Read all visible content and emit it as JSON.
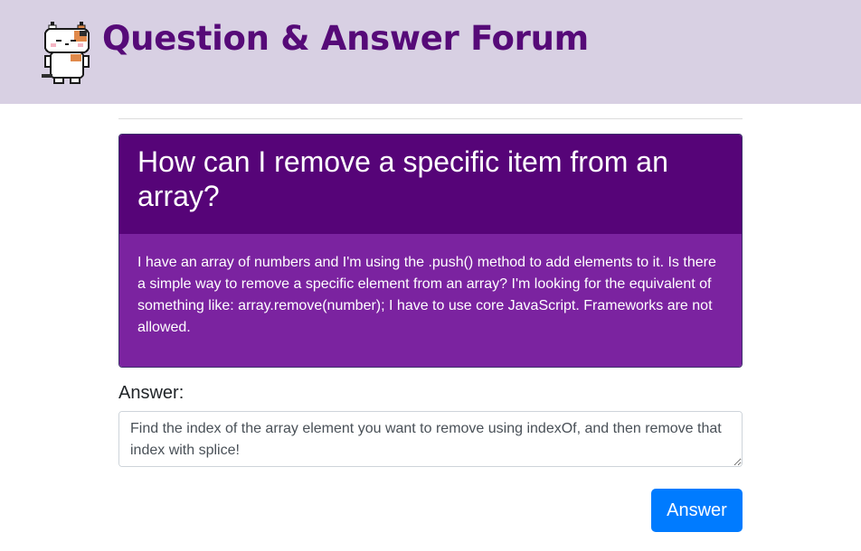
{
  "header": {
    "title": "Question & Answer Forum",
    "logo_icon": "pixel-cat-icon",
    "background": "#d8d0e3",
    "title_color": "#560a78"
  },
  "question": {
    "title": "How can I remove a specific item from an array?",
    "body": "I have an array of numbers and I'm using the .push() method to add elements to it. Is there a simple way to remove a specific element from an array? I'm looking for the equivalent of something like: array.remove(number); I have to use core JavaScript. Frameworks are not allowed.",
    "head_color": "#560478",
    "body_color": "#7b23a0"
  },
  "answer_form": {
    "label": "Answer:",
    "value": "Find the index of the array element you want to remove using indexOf, and then remove that index with splice!",
    "button_label": "Answer",
    "button_color": "#007bff"
  }
}
